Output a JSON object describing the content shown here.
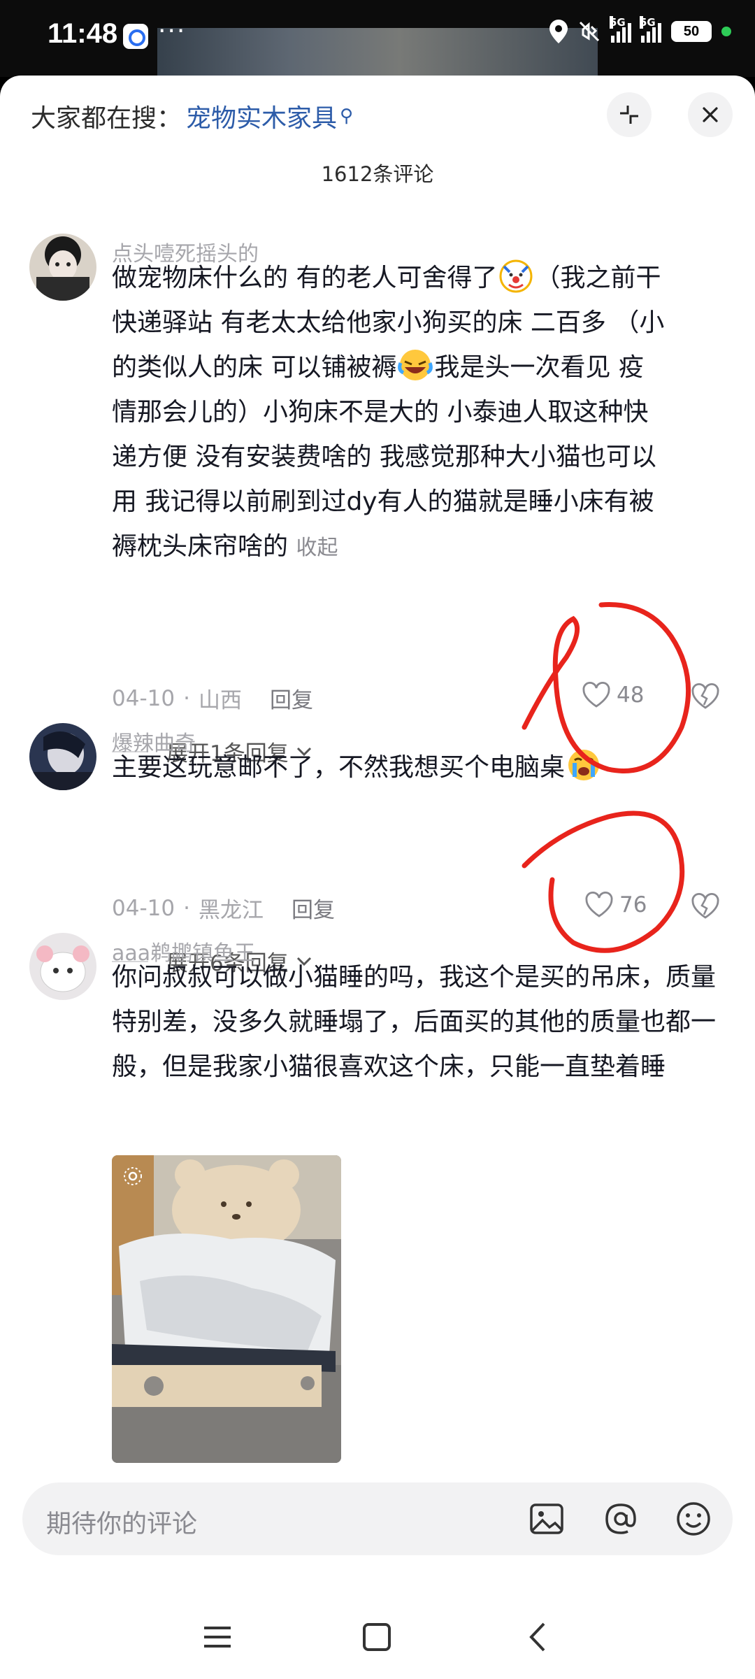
{
  "status_bar": {
    "time": "11:48",
    "dots": "···",
    "battery": "50",
    "network": [
      "5G",
      "5G"
    ],
    "icons": [
      "app-badge-icon",
      "location-icon",
      "mute-icon",
      "signal-icon",
      "battery-icon"
    ]
  },
  "header": {
    "search_prefix": "大家都在搜：",
    "search_keyword": "宠物实木家具",
    "comment_count": "1612条评论",
    "icons": [
      "collapse-icon",
      "close-icon"
    ]
  },
  "comments": [
    {
      "username": "点头噎死摇头的",
      "lines": [
        "做宠物床什么的 有的老人可舍得了",
        "（我之前干",
        "快递驿站 有老太太给他家小狗买的床 二百多 （小",
        "的类似人的床 可以铺被褥",
        "我是头一次看见 疫",
        "情那会儿的）小狗床不是大的  小泰迪人取这种快",
        "递方便 没有安装费啥的  我感觉那种大小猫也可以",
        "用 我记得以前刷到过dy有人的猫就是睡小床有被",
        "褥枕头床帘啥的"
      ],
      "collapse_label": "收起",
      "date": "04-10",
      "location": "山西",
      "reply_label": "回复",
      "likes": "48",
      "expand_label": "展开1条回复"
    },
    {
      "username": "爆辣曲奇",
      "text": "主要这玩意邮不了，不然我想买个电脑桌",
      "date": "04-10",
      "location": "黑龙江",
      "reply_label": "回复",
      "likes": "76",
      "expand_label": "展开6条回复"
    },
    {
      "username": "aaa鹈鹕镇鱼王",
      "text": "你问叔叔可以做小猫睡的吗，我这个是买的吊床，质量特别差，没多久就睡塌了，后面买的其他的质量也都一般，但是我家小猫很喜欢这个床，只能一直垫着睡",
      "image": "cat-bed-photo"
    }
  ],
  "input": {
    "placeholder": "期待你的评论",
    "icons": [
      "image-icon",
      "at-icon",
      "emoji-icon"
    ]
  },
  "nav": {
    "icons": [
      "menu-icon",
      "home-icon",
      "back-icon"
    ]
  },
  "colors": {
    "keyword": "#2d5ca9",
    "annotation_red": "#e8241c",
    "meta_gray": "#a6a6ab"
  }
}
